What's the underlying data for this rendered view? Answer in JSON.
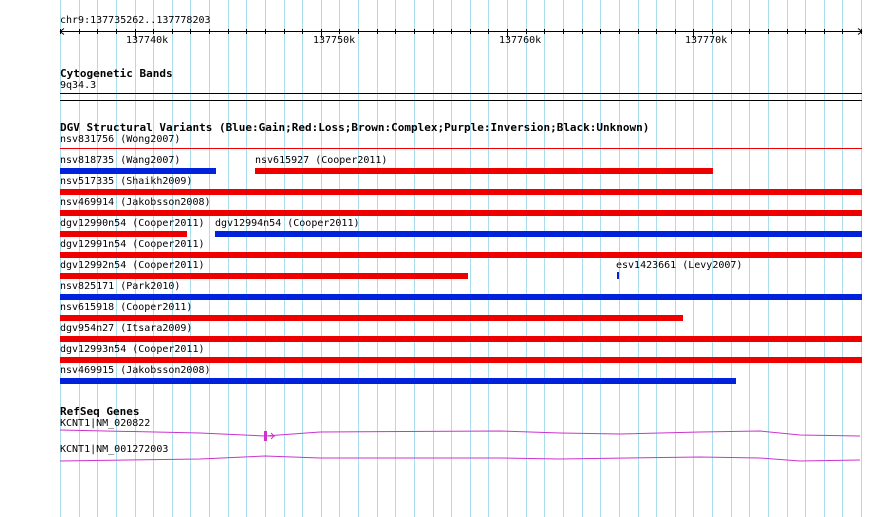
{
  "ruler": {
    "coordinate_label": "chr9:137735262..137778203",
    "ticks": [
      "137740k",
      "137750k",
      "137760k",
      "137770k"
    ]
  },
  "cytoband": {
    "title": "Cytogenetic Bands",
    "band": "9q34.3"
  },
  "dgv": {
    "title": "DGV Structural Variants (Blue:Gain;Red:Loss;Brown:Complex;Purple:Inversion;Black:Unknown)",
    "colors": {
      "gain": "#0022dd",
      "loss": "#ee0000",
      "unknown": "#000000"
    },
    "features": [
      {
        "label": "nsv831756 (Wong2007)",
        "type": "loss"
      },
      {
        "label": "nsv818735 (Wang2007)",
        "type": "gain"
      },
      {
        "label": "nsv615927 (Cooper2011)",
        "type": "loss"
      },
      {
        "label": "nsv517335 (Shaikh2009)",
        "type": "loss"
      },
      {
        "label": "nsv469914 (Jakobsson2008)",
        "type": "loss"
      },
      {
        "label": "dgv12990n54 (Cooper2011)",
        "type": "loss"
      },
      {
        "label": "dgv12994n54 (Cooper2011)",
        "type": "gain"
      },
      {
        "label": "dgv12991n54 (Cooper2011)",
        "type": "loss"
      },
      {
        "label": "dgv12992n54 (Cooper2011)",
        "type": "loss"
      },
      {
        "label": "esv1423661 (Levy2007)",
        "type": "gain"
      },
      {
        "label": "nsv825171 (Park2010)",
        "type": "gain"
      },
      {
        "label": "nsv615918 (Cooper2011)",
        "type": "loss"
      },
      {
        "label": "dgv954n27 (Itsara2009)",
        "type": "loss"
      },
      {
        "label": "dgv12993n54 (Cooper2011)",
        "type": "loss"
      },
      {
        "label": "nsv469915 (Jakobsson2008)",
        "type": "gain"
      }
    ]
  },
  "refseq": {
    "title": "RefSeq Genes",
    "gene_color": "#cc33cc",
    "genes": [
      {
        "label": "KCNT1|NM_020822"
      },
      {
        "label": "KCNT1|NM_001272003"
      }
    ]
  },
  "grid_color": "#aadeee"
}
